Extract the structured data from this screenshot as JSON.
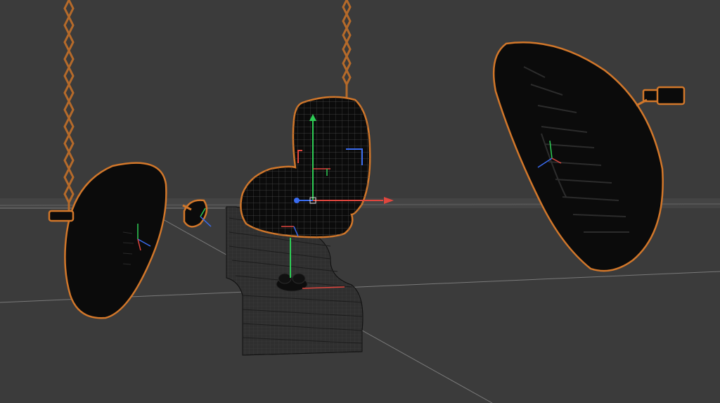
{
  "viewport": {
    "background": "#3b3b3b",
    "grid_color": "#8a8a8a",
    "horizon_color": "#5a5a5a"
  },
  "colors": {
    "selection_outline": "#d2772a",
    "object_fill": "#0b0b0b",
    "wireframe": "#4a4a4a",
    "axis_x": "#e0463e",
    "axis_y": "#2ecc55",
    "axis_z": "#3a6cf0",
    "chain": "#b56a2a"
  },
  "scene": {
    "objects": [
      {
        "name": "hanging-chain-left",
        "kind": "chain"
      },
      {
        "name": "hanging-chain-center",
        "kind": "chain"
      },
      {
        "name": "softbox-left",
        "kind": "softbox"
      },
      {
        "name": "small-spotlight",
        "kind": "spot"
      },
      {
        "name": "heart-light",
        "kind": "light"
      },
      {
        "name": "softbox-right",
        "kind": "softbox"
      },
      {
        "name": "curved-backdrop",
        "kind": "backdrop"
      },
      {
        "name": "ground-object",
        "kind": "mesh"
      }
    ]
  }
}
